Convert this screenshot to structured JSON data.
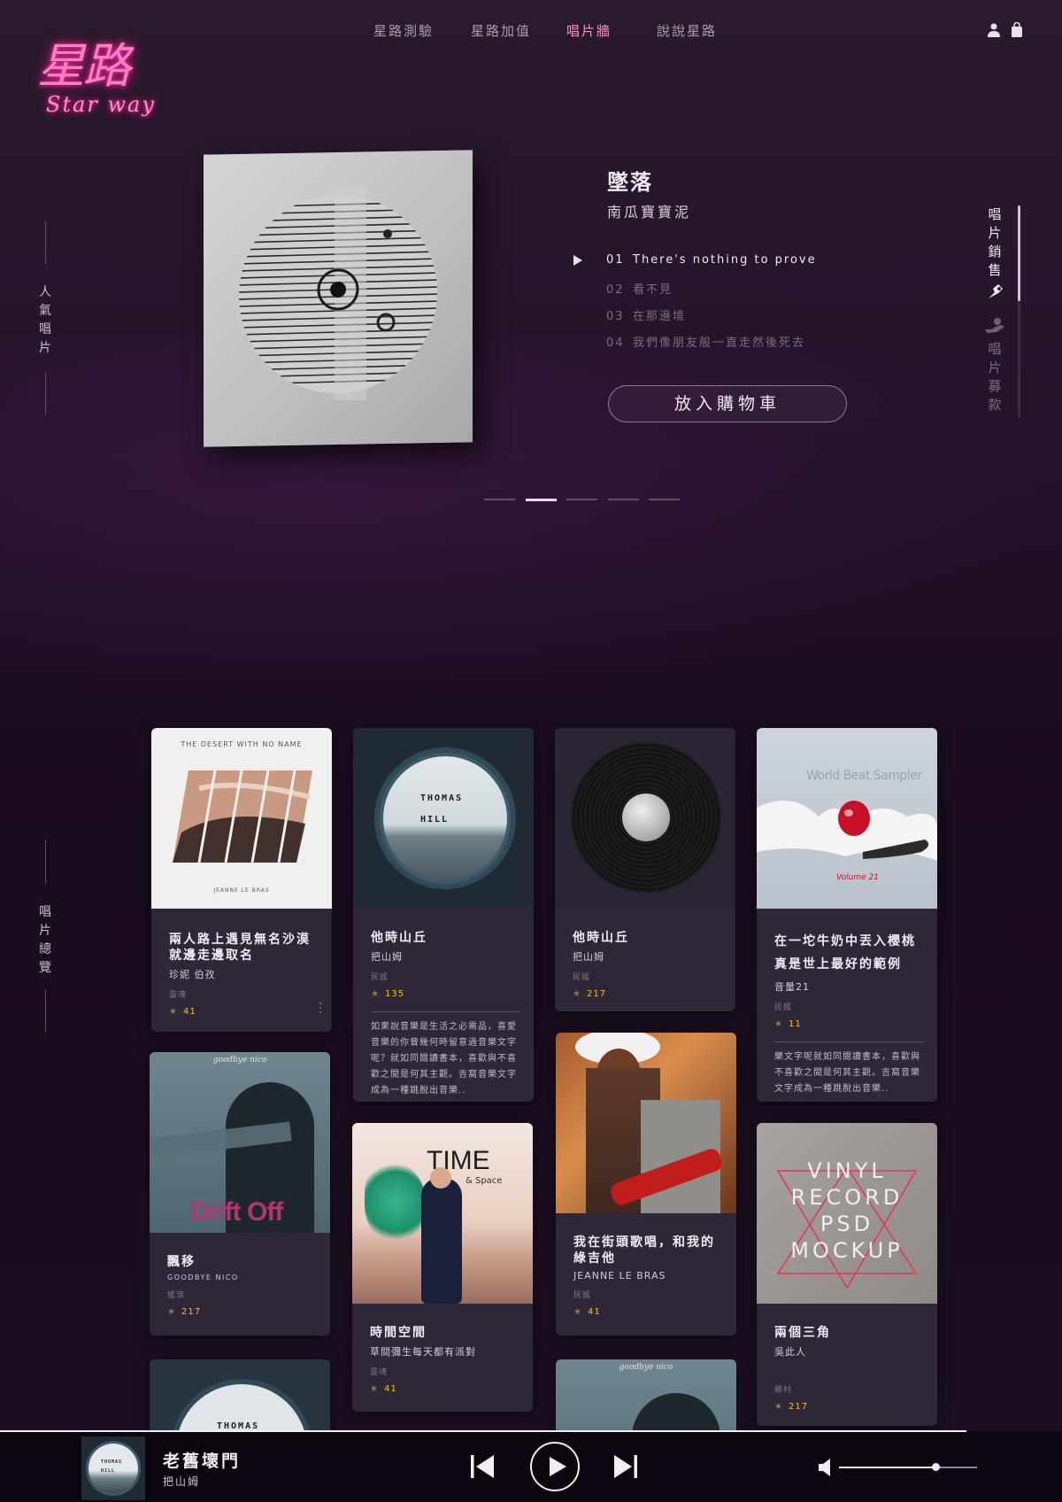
{
  "brand": {
    "logo_cn": "星路",
    "logo_en": "Star way",
    "accent": "#ff5fb0"
  },
  "nav": {
    "items": [
      "星路測驗",
      "星路加值",
      "唱片牆",
      "說說星路"
    ],
    "active": "唱片牆"
  },
  "header_icons": [
    "user-icon",
    "shopping-bag-icon"
  ],
  "side_labels": {
    "popular": "人氣唱片",
    "overview": "唱片總覽"
  },
  "right_tabs": {
    "sales": "唱片銷售",
    "fundraise": "唱片募款"
  },
  "hero": {
    "title": "墜落",
    "artist": "南瓜寶寶泥",
    "tracks": [
      {
        "num": "01",
        "name": "There's nothing to prove"
      },
      {
        "num": "02",
        "name": "看不見"
      },
      {
        "num": "03",
        "name": "在那邊境"
      },
      {
        "num": "04",
        "name": "我們像朋友般一直走然後死去"
      }
    ],
    "playing_track_index": 0,
    "cart_label": "放入購物車",
    "slides_count": 5,
    "active_slide": 1
  },
  "albums": [
    {
      "id": "a1",
      "title": "兩人路上遇見無名沙漠就邊走邊取名",
      "artist": "珍妮 伯孜",
      "genre": "靈魂",
      "rating": "41",
      "cover_text": [
        "THE DESERT WITH NO NAME",
        "JEANNE LE BRAS"
      ]
    },
    {
      "id": "a2",
      "title": "他時山丘",
      "artist": "把山姆",
      "genre": "民謠",
      "rating": "135",
      "desc": "如果說音樂是生活之必需品，喜愛音樂的你曾幾何時留意過音樂文字呢？就如同閱讀書本，喜歡與不喜歡之間是何其主觀。吉窩音樂文字成為一種跳脫出音樂..",
      "cover_text": [
        "THOMAS",
        "HILL"
      ]
    },
    {
      "id": "a3",
      "title": "他時山丘",
      "artist": "把山姆",
      "genre": "民謠",
      "rating": "217"
    },
    {
      "id": "a4",
      "title": "在一坨牛奶中丟入櫻桃真是世上最好的範例",
      "artist": "音量21",
      "genre": "民謠",
      "rating": "11",
      "desc": "樂文字呢就如同閱讀書本，喜歡與不喜歡之間是何其主觀。吉窩音樂文字成為一種跳脫出音樂..",
      "cover_text": [
        "World Beat Sampler",
        "Volume 21"
      ]
    },
    {
      "id": "a5",
      "title": "飄移",
      "artist": "GOODBYE NICO",
      "genre": "搖滾",
      "rating": "217",
      "cover_text": [
        "goodbye nico",
        "Drift Off"
      ]
    },
    {
      "id": "a6",
      "title": "時間空間",
      "artist": "草間彌生每天都有派對",
      "genre": "靈魂",
      "rating": "41",
      "cover_text": [
        "TIME",
        "& Space"
      ]
    },
    {
      "id": "a7",
      "title": "我在街頭歌唱，和我的綠吉他",
      "artist": "JEANNE LE BRAS",
      "genre": "民謠",
      "rating": "41"
    },
    {
      "id": "a8",
      "title": "兩個三角",
      "artist": "吳此人",
      "genre": "鄉村",
      "rating": "217",
      "cover_text": [
        "VINYL",
        "RECORD",
        "PSD",
        "MOCKUP"
      ]
    },
    {
      "id": "a9",
      "cover_text": [
        "THOMAS"
      ]
    },
    {
      "id": "a10",
      "cover_text": [
        "goodbye nico"
      ]
    }
  ],
  "player": {
    "title": "老舊壞門",
    "artist": "把山姆",
    "progress": 0.91,
    "volume": 0.7,
    "thumb_text": [
      "THOMAS",
      "HILL"
    ]
  }
}
